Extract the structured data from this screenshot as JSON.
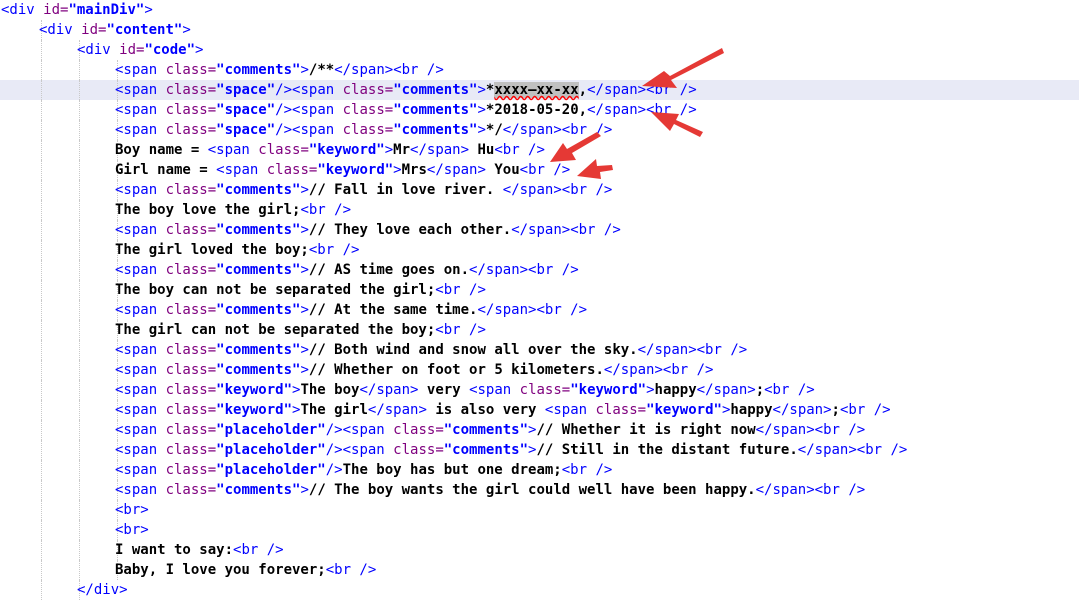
{
  "editor": {
    "current_line": 4,
    "arrow_color": "#e53935",
    "syntax_colors": {
      "tag": "#0000ff",
      "attribute": "#7f007f",
      "value": "#0000ff",
      "text": "#000000"
    },
    "lines": [
      {
        "indent": 0,
        "segments": [
          {
            "k": "t",
            "s": "<div "
          },
          {
            "k": "a",
            "s": "id="
          },
          {
            "k": "v",
            "s": "\"mainDiv\""
          },
          {
            "k": "t",
            "s": ">"
          }
        ]
      },
      {
        "indent": 1,
        "segments": [
          {
            "k": "t",
            "s": "<div "
          },
          {
            "k": "a",
            "s": "id="
          },
          {
            "k": "v",
            "s": "\"content\""
          },
          {
            "k": "t",
            "s": ">"
          }
        ]
      },
      {
        "indent": 2,
        "segments": [
          {
            "k": "t",
            "s": "<div "
          },
          {
            "k": "a",
            "s": "id="
          },
          {
            "k": "v",
            "s": "\"code\""
          },
          {
            "k": "t",
            "s": ">"
          }
        ]
      },
      {
        "indent": 3,
        "segments": [
          {
            "k": "t",
            "s": "<span "
          },
          {
            "k": "a",
            "s": "class="
          },
          {
            "k": "v",
            "s": "\"comments\""
          },
          {
            "k": "t",
            "s": ">"
          },
          {
            "k": "x",
            "s": "/**"
          },
          {
            "k": "t",
            "s": "</span><br />"
          }
        ]
      },
      {
        "indent": 3,
        "segments": [
          {
            "k": "t",
            "s": "<span "
          },
          {
            "k": "a",
            "s": "class="
          },
          {
            "k": "v",
            "s": "\"space\""
          },
          {
            "k": "t",
            "s": "/><span "
          },
          {
            "k": "a",
            "s": "class="
          },
          {
            "k": "v",
            "s": "\"comments\""
          },
          {
            "k": "t",
            "s": ">"
          },
          {
            "k": "x",
            "s": "*"
          },
          {
            "k": "x",
            "s": "xxxx—xx-xx",
            "sel": true,
            "sq": true
          },
          {
            "k": "x",
            "s": ","
          },
          {
            "k": "t",
            "s": "</span><br />"
          }
        ]
      },
      {
        "indent": 3,
        "segments": [
          {
            "k": "t",
            "s": "<span "
          },
          {
            "k": "a",
            "s": "class="
          },
          {
            "k": "v",
            "s": "\"space\""
          },
          {
            "k": "t",
            "s": "/><span "
          },
          {
            "k": "a",
            "s": "class="
          },
          {
            "k": "v",
            "s": "\"comments\""
          },
          {
            "k": "t",
            "s": ">"
          },
          {
            "k": "x",
            "s": "*2018-05-20,"
          },
          {
            "k": "t",
            "s": "</span><br />"
          }
        ]
      },
      {
        "indent": 3,
        "segments": [
          {
            "k": "t",
            "s": "<span "
          },
          {
            "k": "a",
            "s": "class="
          },
          {
            "k": "v",
            "s": "\"space\""
          },
          {
            "k": "t",
            "s": "/><span "
          },
          {
            "k": "a",
            "s": "class="
          },
          {
            "k": "v",
            "s": "\"comments\""
          },
          {
            "k": "t",
            "s": ">"
          },
          {
            "k": "x",
            "s": "*/"
          },
          {
            "k": "t",
            "s": "</span><br />"
          }
        ]
      },
      {
        "indent": 3,
        "segments": [
          {
            "k": "x",
            "s": "Boy name = "
          },
          {
            "k": "t",
            "s": "<span "
          },
          {
            "k": "a",
            "s": "class="
          },
          {
            "k": "v",
            "s": "\"keyword\""
          },
          {
            "k": "t",
            "s": ">"
          },
          {
            "k": "x",
            "s": "Mr"
          },
          {
            "k": "t",
            "s": "</span>"
          },
          {
            "k": "x",
            "s": " Hu"
          },
          {
            "k": "t",
            "s": "<br />"
          }
        ]
      },
      {
        "indent": 3,
        "segments": [
          {
            "k": "x",
            "s": "Girl name = "
          },
          {
            "k": "t",
            "s": "<span "
          },
          {
            "k": "a",
            "s": "class="
          },
          {
            "k": "v",
            "s": "\"keyword\""
          },
          {
            "k": "t",
            "s": ">"
          },
          {
            "k": "x",
            "s": "Mrs"
          },
          {
            "k": "t",
            "s": "</span>"
          },
          {
            "k": "x",
            "s": " You"
          },
          {
            "k": "t",
            "s": "<br />"
          }
        ]
      },
      {
        "indent": 3,
        "segments": [
          {
            "k": "t",
            "s": "<span "
          },
          {
            "k": "a",
            "s": "class="
          },
          {
            "k": "v",
            "s": "\"comments\""
          },
          {
            "k": "t",
            "s": ">"
          },
          {
            "k": "x",
            "s": "// Fall in love river. "
          },
          {
            "k": "t",
            "s": "</span><br />"
          }
        ]
      },
      {
        "indent": 3,
        "segments": [
          {
            "k": "x",
            "s": "The boy love the girl;"
          },
          {
            "k": "t",
            "s": "<br />"
          }
        ]
      },
      {
        "indent": 3,
        "segments": [
          {
            "k": "t",
            "s": "<span "
          },
          {
            "k": "a",
            "s": "class="
          },
          {
            "k": "v",
            "s": "\"comments\""
          },
          {
            "k": "t",
            "s": ">"
          },
          {
            "k": "x",
            "s": "// They love each other."
          },
          {
            "k": "t",
            "s": "</span><br />"
          }
        ]
      },
      {
        "indent": 3,
        "segments": [
          {
            "k": "x",
            "s": "The girl loved the boy;"
          },
          {
            "k": "t",
            "s": "<br />"
          }
        ]
      },
      {
        "indent": 3,
        "segments": [
          {
            "k": "t",
            "s": "<span "
          },
          {
            "k": "a",
            "s": "class="
          },
          {
            "k": "v",
            "s": "\"comments\""
          },
          {
            "k": "t",
            "s": ">"
          },
          {
            "k": "x",
            "s": "// AS time goes on."
          },
          {
            "k": "t",
            "s": "</span><br />"
          }
        ]
      },
      {
        "indent": 3,
        "segments": [
          {
            "k": "x",
            "s": "The boy can not be separated the girl;"
          },
          {
            "k": "t",
            "s": "<br />"
          }
        ]
      },
      {
        "indent": 3,
        "segments": [
          {
            "k": "t",
            "s": "<span "
          },
          {
            "k": "a",
            "s": "class="
          },
          {
            "k": "v",
            "s": "\"comments\""
          },
          {
            "k": "t",
            "s": ">"
          },
          {
            "k": "x",
            "s": "// At the same time."
          },
          {
            "k": "t",
            "s": "</span><br />"
          }
        ]
      },
      {
        "indent": 3,
        "segments": [
          {
            "k": "x",
            "s": "The girl can not be separated the boy;"
          },
          {
            "k": "t",
            "s": "<br />"
          }
        ]
      },
      {
        "indent": 3,
        "segments": [
          {
            "k": "t",
            "s": "<span "
          },
          {
            "k": "a",
            "s": "class="
          },
          {
            "k": "v",
            "s": "\"comments\""
          },
          {
            "k": "t",
            "s": ">"
          },
          {
            "k": "x",
            "s": "// Both wind and snow all over the sky."
          },
          {
            "k": "t",
            "s": "</span><br />"
          }
        ]
      },
      {
        "indent": 3,
        "segments": [
          {
            "k": "t",
            "s": "<span "
          },
          {
            "k": "a",
            "s": "class="
          },
          {
            "k": "v",
            "s": "\"comments\""
          },
          {
            "k": "t",
            "s": ">"
          },
          {
            "k": "x",
            "s": "// Whether on foot or 5 kilometers."
          },
          {
            "k": "t",
            "s": "</span><br />"
          }
        ]
      },
      {
        "indent": 3,
        "segments": [
          {
            "k": "t",
            "s": "<span "
          },
          {
            "k": "a",
            "s": "class="
          },
          {
            "k": "v",
            "s": "\"keyword\""
          },
          {
            "k": "t",
            "s": ">"
          },
          {
            "k": "x",
            "s": "The boy"
          },
          {
            "k": "t",
            "s": "</span>"
          },
          {
            "k": "x",
            "s": " very "
          },
          {
            "k": "t",
            "s": "<span "
          },
          {
            "k": "a",
            "s": "class="
          },
          {
            "k": "v",
            "s": "\"keyword\""
          },
          {
            "k": "t",
            "s": ">"
          },
          {
            "k": "x",
            "s": "happy"
          },
          {
            "k": "t",
            "s": "</span>"
          },
          {
            "k": "x",
            "s": ";"
          },
          {
            "k": "t",
            "s": "<br />"
          }
        ]
      },
      {
        "indent": 3,
        "segments": [
          {
            "k": "t",
            "s": "<span "
          },
          {
            "k": "a",
            "s": "class="
          },
          {
            "k": "v",
            "s": "\"keyword\""
          },
          {
            "k": "t",
            "s": ">"
          },
          {
            "k": "x",
            "s": "The girl"
          },
          {
            "k": "t",
            "s": "</span>"
          },
          {
            "k": "x",
            "s": " is also very "
          },
          {
            "k": "t",
            "s": "<span "
          },
          {
            "k": "a",
            "s": "class="
          },
          {
            "k": "v",
            "s": "\"keyword\""
          },
          {
            "k": "t",
            "s": ">"
          },
          {
            "k": "x",
            "s": "happy"
          },
          {
            "k": "t",
            "s": "</span>"
          },
          {
            "k": "x",
            "s": ";"
          },
          {
            "k": "t",
            "s": "<br />"
          }
        ]
      },
      {
        "indent": 3,
        "segments": [
          {
            "k": "t",
            "s": "<span "
          },
          {
            "k": "a",
            "s": "class="
          },
          {
            "k": "v",
            "s": "\"placeholder\""
          },
          {
            "k": "t",
            "s": "/><span "
          },
          {
            "k": "a",
            "s": "class="
          },
          {
            "k": "v",
            "s": "\"comments\""
          },
          {
            "k": "t",
            "s": ">"
          },
          {
            "k": "x",
            "s": "// Whether it is right now"
          },
          {
            "k": "t",
            "s": "</span><br />"
          }
        ]
      },
      {
        "indent": 3,
        "segments": [
          {
            "k": "t",
            "s": "<span "
          },
          {
            "k": "a",
            "s": "class="
          },
          {
            "k": "v",
            "s": "\"placeholder\""
          },
          {
            "k": "t",
            "s": "/><span "
          },
          {
            "k": "a",
            "s": "class="
          },
          {
            "k": "v",
            "s": "\"comments\""
          },
          {
            "k": "t",
            "s": ">"
          },
          {
            "k": "x",
            "s": "// Still in the distant future."
          },
          {
            "k": "t",
            "s": "</span><br />"
          }
        ]
      },
      {
        "indent": 3,
        "segments": [
          {
            "k": "t",
            "s": "<span "
          },
          {
            "k": "a",
            "s": "class="
          },
          {
            "k": "v",
            "s": "\"placeholder\""
          },
          {
            "k": "t",
            "s": "/>"
          },
          {
            "k": "x",
            "s": "The boy has but one dream;"
          },
          {
            "k": "t",
            "s": "<br />"
          }
        ]
      },
      {
        "indent": 3,
        "segments": [
          {
            "k": "t",
            "s": "<span "
          },
          {
            "k": "a",
            "s": "class="
          },
          {
            "k": "v",
            "s": "\"comments\""
          },
          {
            "k": "t",
            "s": ">"
          },
          {
            "k": "x",
            "s": "// The boy wants the girl could well have been happy."
          },
          {
            "k": "t",
            "s": "</span><br />"
          }
        ]
      },
      {
        "indent": 3,
        "segments": [
          {
            "k": "t",
            "s": "<br>"
          }
        ]
      },
      {
        "indent": 3,
        "segments": [
          {
            "k": "t",
            "s": "<br>"
          }
        ]
      },
      {
        "indent": 3,
        "segments": [
          {
            "k": "x",
            "s": "I want to say:"
          },
          {
            "k": "t",
            "s": "<br />"
          }
        ]
      },
      {
        "indent": 3,
        "segments": [
          {
            "k": "x",
            "s": "Baby, I love you forever;"
          },
          {
            "k": "t",
            "s": "<br />"
          }
        ]
      },
      {
        "indent": 2,
        "segments": [
          {
            "k": "t",
            "s": "</div>"
          }
        ]
      }
    ]
  }
}
